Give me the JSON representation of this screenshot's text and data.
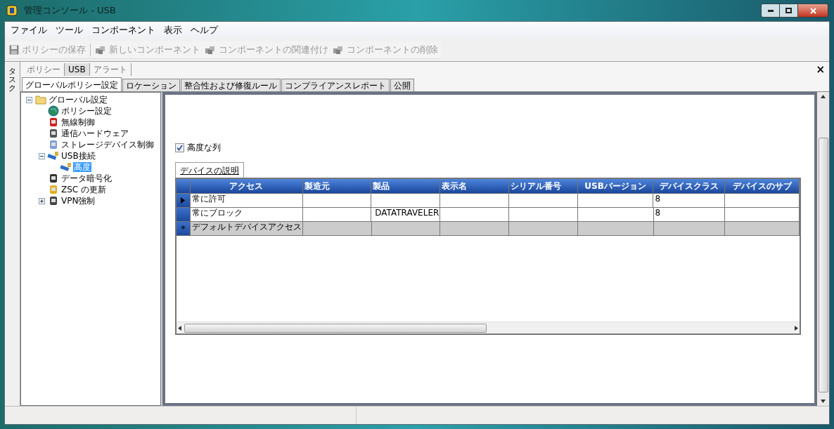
{
  "window": {
    "title": "管理コンソール - USB"
  },
  "menu": [
    "ファイル",
    "ツール",
    "コンポーネント",
    "表示",
    "ヘルプ"
  ],
  "toolbar": [
    {
      "label": "ポリシーの保存",
      "disabled": true,
      "kind": "save"
    },
    {
      "label": "新しいコンポーネント",
      "disabled": true,
      "kind": "new"
    },
    {
      "label": "コンポーネントの関連付け",
      "disabled": true,
      "kind": "link"
    },
    {
      "label": "コンポーネントの削除",
      "disabled": true,
      "kind": "delete"
    }
  ],
  "side_tab": "タスク",
  "top_tabs": [
    {
      "label": "ポリシー",
      "selected": false
    },
    {
      "label": "USB",
      "selected": true
    },
    {
      "label": "アラート",
      "selected": false
    }
  ],
  "close_glyph": "×",
  "tabs": [
    {
      "label": "グローバルポリシー設定",
      "selected": true
    },
    {
      "label": "ロケーション",
      "selected": false
    },
    {
      "label": "整合性および修復ルール",
      "selected": false
    },
    {
      "label": "コンプライアンスレポート",
      "selected": false
    },
    {
      "label": "公開",
      "selected": false
    }
  ],
  "tree": [
    {
      "label": "グローバル設定",
      "expanded": true,
      "selected": false,
      "children": [
        {
          "label": "ポリシー設定",
          "selected": false
        },
        {
          "label": "無線制御",
          "selected": false
        },
        {
          "label": "通信ハードウェア",
          "selected": false
        },
        {
          "label": "ストレージデバイス制御",
          "selected": false
        },
        {
          "label": "USB接続",
          "expanded": true,
          "selected": false,
          "children": [
            {
              "label": "高度",
              "selected": true
            }
          ]
        },
        {
          "label": "データ暗号化",
          "selected": false
        },
        {
          "label": "ZSC の更新",
          "selected": false
        },
        {
          "label": "VPN強制",
          "expanded": false,
          "selected": false
        }
      ]
    }
  ],
  "advanced_columns": {
    "label": "高度な列",
    "checked": true
  },
  "grid_tab": "デバイスの説明",
  "grid": {
    "columns": [
      {
        "label": "アクセス"
      },
      {
        "label": "製造元"
      },
      {
        "label": "製品"
      },
      {
        "label": "表示名"
      },
      {
        "label": "シリアル番号"
      },
      {
        "label": "USBバージョン"
      },
      {
        "label": "デバイスクラス"
      },
      {
        "label": "デバイスのサブ"
      }
    ],
    "rows": [
      {
        "kind": "data",
        "selected": true,
        "cells": [
          "常に許可",
          "",
          "",
          "",
          "",
          "",
          "8",
          ""
        ]
      },
      {
        "kind": "data",
        "selected": false,
        "cells": [
          "常にブロック",
          "",
          "DATATRAVELER",
          "",
          "",
          "",
          "8",
          ""
        ]
      },
      {
        "kind": "new",
        "selected": false,
        "marker": "*",
        "cells": [
          "デフォルトデバイスアクセス",
          "",
          "",
          "",
          "",
          "",
          "",
          ""
        ]
      }
    ]
  }
}
